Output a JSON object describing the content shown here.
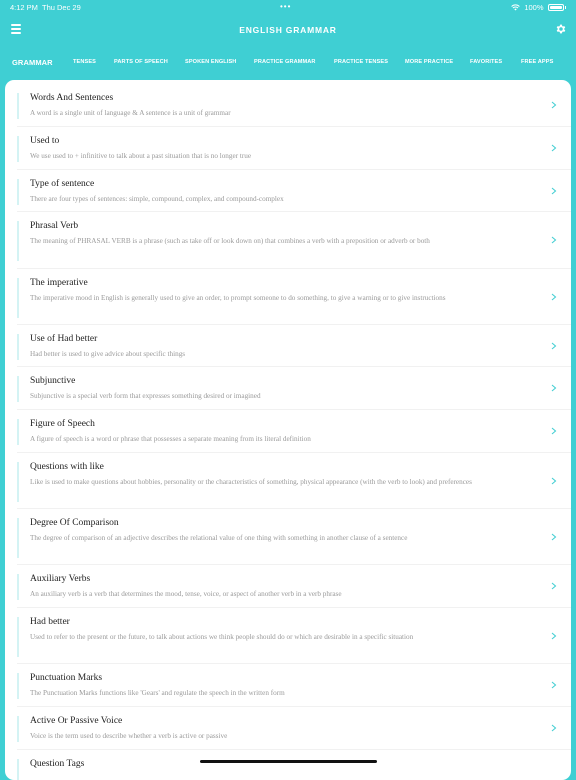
{
  "status_bar": {
    "time": "4:12 PM",
    "date": "Thu Dec 29",
    "dots": "•••",
    "battery": "100%"
  },
  "header": {
    "title": "ENGLISH GRAMMAR"
  },
  "tabs": [
    {
      "label": "GRAMMAR",
      "active": true
    },
    {
      "label": "TENSES"
    },
    {
      "label": "PARTS OF SPEECH"
    },
    {
      "label": "SPOKEN ENGLISH"
    },
    {
      "label": "PRACTICE GRAMMAR"
    },
    {
      "label": "PRACTICE TENSES"
    },
    {
      "label": "MORE PRACTICE"
    },
    {
      "label": "FAVORITES"
    },
    {
      "label": "FREE APPS"
    }
  ],
  "items": [
    {
      "title": "Words And Sentences",
      "description": "A word is a single unit of language & A sentence is a unit of grammar"
    },
    {
      "title": "Used to",
      "description": "We use used to + infinitive to talk about a past situation that is no longer true"
    },
    {
      "title": "Type of sentence",
      "description": "There are four types of sentences: simple, compound, complex, and compound-complex"
    },
    {
      "title": "Phrasal Verb",
      "description": "The meaning of PHRASAL VERB is a phrase (such as take off or look down on) that combines a verb with a preposition or adverb or both"
    },
    {
      "title": "The imperative",
      "description": "The imperative mood in English is generally used to give an order, to prompt someone to do something, to give a warning or to give instructions"
    },
    {
      "title": "Use of Had better",
      "description": "Had better is used to give advice about specific things"
    },
    {
      "title": "Subjunctive",
      "description": "Subjunctive is a special verb form that expresses something desired or imagined"
    },
    {
      "title": "Figure of Speech",
      "description": "A figure of speech is a word or phrase that possesses a separate meaning from its literal definition"
    },
    {
      "title": "Questions with like",
      "description": "Like is used to make questions about hobbies, personality or the characteristics of something, physical appearance (with the verb to look) and preferences"
    },
    {
      "title": "Degree Of Comparison",
      "description": "The degree of comparison of an adjective describes the relational value of one thing with something in another clause of a sentence"
    },
    {
      "title": "Auxiliary Verbs",
      "description": "An auxiliary verb is a verb that determines the mood, tense, voice, or aspect of another verb in a verb phrase"
    },
    {
      "title": "Had better",
      "description": "Used to refer to the present or the future, to talk about actions we think people should do or which are desirable in a specific situation"
    },
    {
      "title": "Punctuation Marks",
      "description": "The Punctuation Marks functions like 'Gears' and regulate the speech in the written form"
    },
    {
      "title": "Active Or Passive Voice",
      "description": "Voice is the term used to describe whether a verb is active or passive"
    },
    {
      "title": "Question Tags",
      "description": ""
    }
  ]
}
